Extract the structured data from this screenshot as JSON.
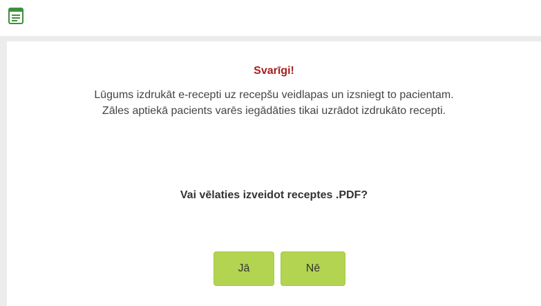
{
  "header": {
    "icon": "document-window-icon"
  },
  "dialog": {
    "title": "Svarīgi!",
    "message_line1": "Lūgums izdrukāt e-recepti uz recepšu veidlapas un izsniegt to pacientam.",
    "message_line2": "Zāles aptiekā pacients varēs iegādāties tikai uzrādot izdrukāto recepti.",
    "question": "Vai vēlaties izveidot receptes .PDF?",
    "yes_label": "Jā",
    "no_label": "Nē"
  },
  "colors": {
    "title": "#a31e1e",
    "button": "#b2d451",
    "frame": "#ececec",
    "icon": "#3f8f3f"
  }
}
